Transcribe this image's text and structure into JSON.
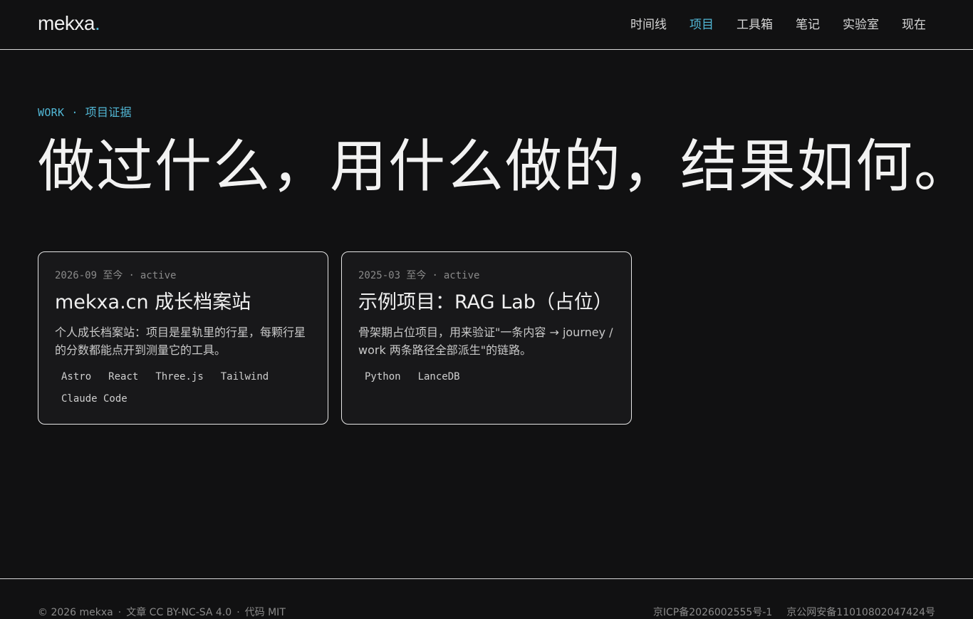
{
  "header": {
    "logo_text": "mekxa",
    "logo_dot": ".",
    "nav": [
      {
        "label": "时间线"
      },
      {
        "label": "项目"
      },
      {
        "label": "工具箱"
      },
      {
        "label": "笔记"
      },
      {
        "label": "实验室"
      },
      {
        "label": "现在"
      }
    ],
    "active_nav": "项目"
  },
  "hero": {
    "eyebrow_en": "WORK",
    "eyebrow_sep": "·",
    "eyebrow_zh": "项目证据",
    "title": "做过什么，用什么做的，结果如何。"
  },
  "projects": [
    {
      "date": "2026-09 至今",
      "sep": "·",
      "status": "active",
      "title": "mekxa.cn 成长档案站",
      "description": "个人成长档案站：项目是星轨里的行星，每颗行星的分数都能点开到测量它的工具。",
      "tags": [
        "Astro",
        "React",
        "Three.js",
        "Tailwind",
        "Claude Code"
      ]
    },
    {
      "date": "2025-03 至今",
      "sep": "·",
      "status": "active",
      "title": "示例项目：RAG Lab（占位）",
      "description": "骨架期占位项目，用来验证\"一条内容 → journey / work 两条路径全部派生\"的链路。",
      "tags": [
        "Python",
        "LanceDB"
      ]
    }
  ],
  "footer": {
    "copyright": "© 2026 mekxa",
    "license_content": "文章 CC BY-NC-SA 4.0",
    "license_code": "代码 MIT",
    "sep": "·",
    "icp": "京ICP备2026002555号-1",
    "police": "京公网安备11010802047424号"
  },
  "colors": {
    "accent": "#52b8d6",
    "background": "#111112",
    "card_background": "#18181a",
    "border": "#e6e6e6"
  }
}
